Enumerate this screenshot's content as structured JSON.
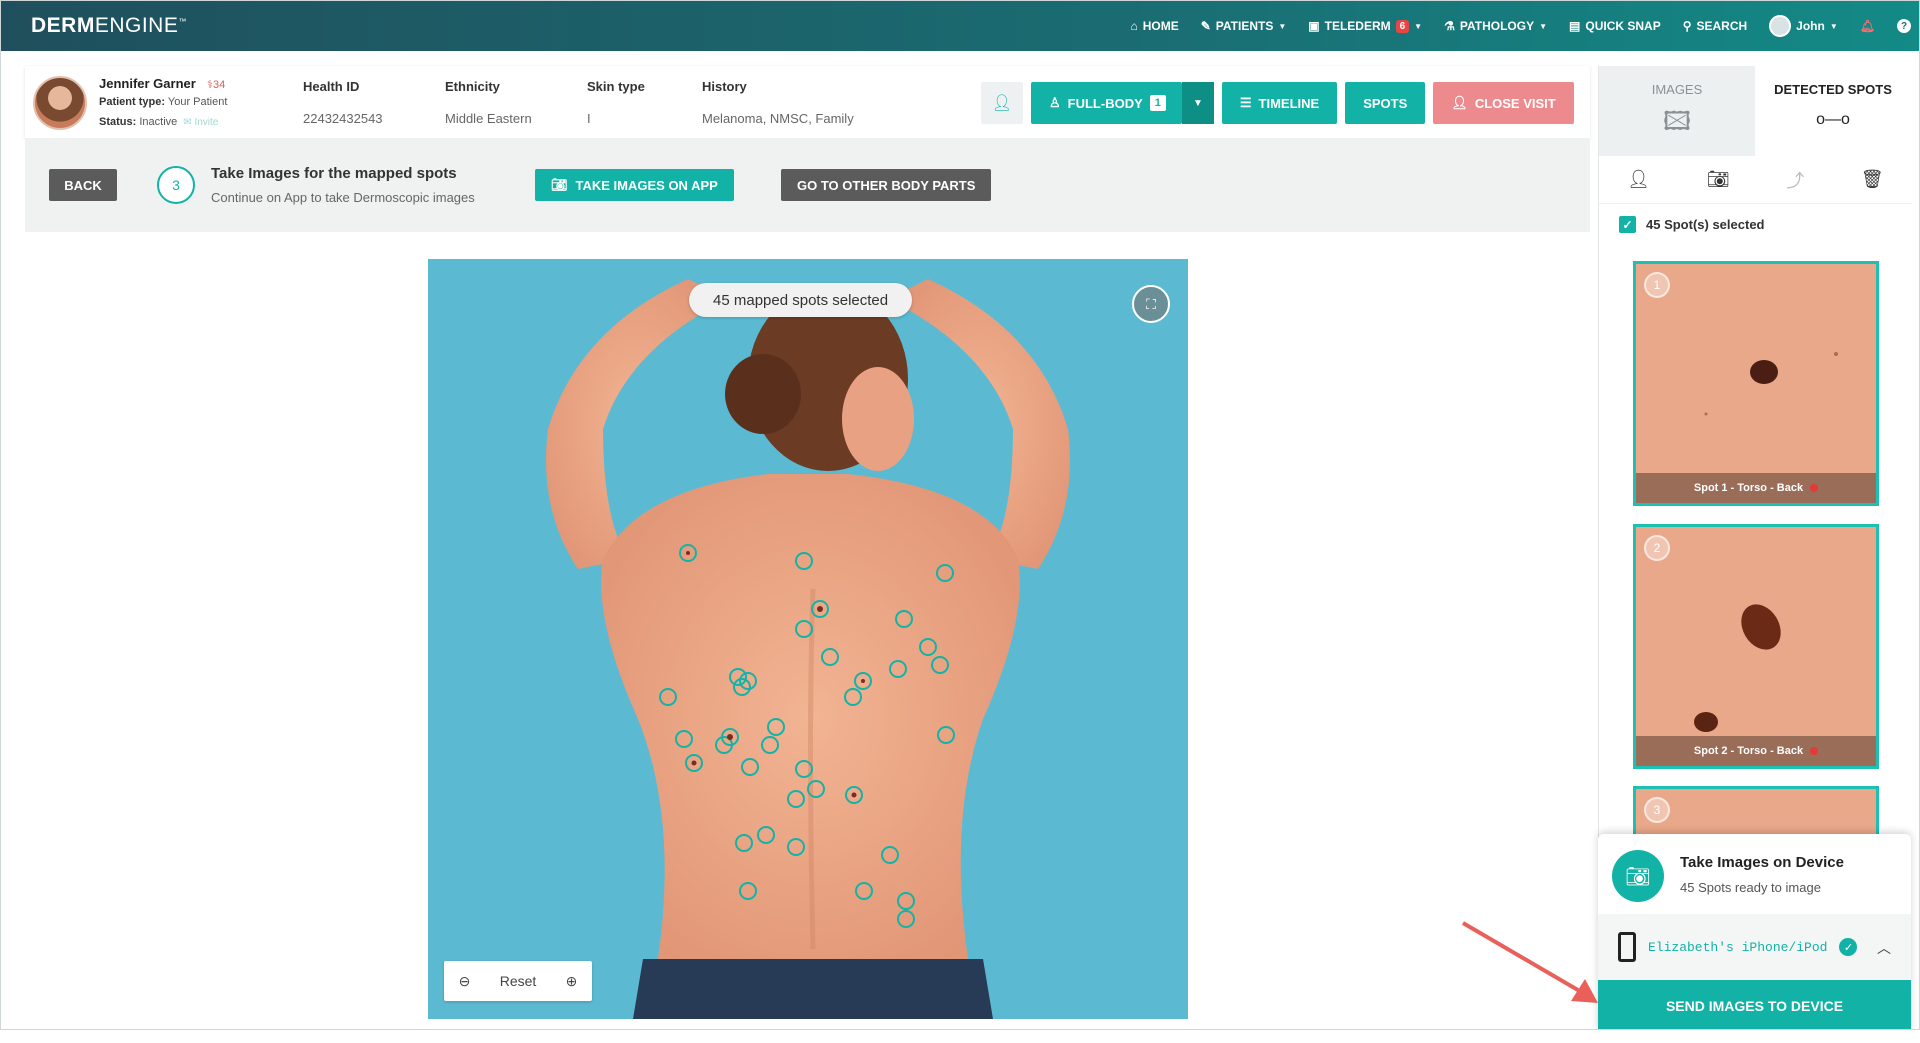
{
  "app": {
    "logo_bold": "DERM",
    "logo_light": "ENGINE",
    "logo_tm": "™"
  },
  "nav": {
    "items": [
      {
        "label": "HOME",
        "icon": "home-icon"
      },
      {
        "label": "PATIENTS",
        "icon": "patients-icon"
      },
      {
        "label": "TELEDERM",
        "icon": "telederm-icon",
        "badge": "6"
      },
      {
        "label": "PATHOLOGY",
        "icon": "pathology-icon"
      },
      {
        "label": "QUICK SNAP",
        "icon": "quick-snap-icon"
      },
      {
        "label": "SEARCH",
        "icon": "search-icon"
      }
    ],
    "user": "John"
  },
  "patient": {
    "name": "Jennifer Garner",
    "age": "34",
    "type_label": "Patient type:",
    "type_value": "Your Patient",
    "status_label": "Status:",
    "status_value": "Inactive",
    "invite": "Invite",
    "health_id_label": "Health ID",
    "health_id": "22432432543",
    "ethnicity_label": "Ethnicity",
    "ethnicity": "Middle Eastern",
    "skin_type_label": "Skin type",
    "skin_type": "I",
    "history_label": "History",
    "history": "Melanoma, NMSC, Family"
  },
  "header_buttons": {
    "full_body": "FULL-BODY",
    "full_body_count": "1",
    "timeline": "TIMELINE",
    "spots": "SPOTS",
    "close_visit": "CLOSE VISIT"
  },
  "step": {
    "back": "BACK",
    "number": "3",
    "title": "Take Images for the mapped spots",
    "subtitle": "Continue on App to take Dermoscopic images",
    "take_images_btn": "TAKE IMAGES ON APP",
    "other_parts_btn": "GO TO OTHER BODY PARTS"
  },
  "viewer": {
    "pill": "45 mapped spots selected",
    "reset": "Reset"
  },
  "right_panel": {
    "tab_images": "IMAGES",
    "tab_detected": "DETECTED SPOTS",
    "selected": "45 Spot(s) selected",
    "spots": [
      {
        "num": "1",
        "label": "Spot 1 - Torso - Back"
      },
      {
        "num": "2",
        "label": "Spot 2 - Torso - Back"
      },
      {
        "num": "3",
        "label": ""
      }
    ]
  },
  "device_panel": {
    "title": "Take Images on Device",
    "subtitle": "45 Spots ready to image",
    "device": "Elizabeth's iPhone/iPod",
    "send": "SEND IMAGES TO DEVICE"
  },
  "colors": {
    "accent": "#12b3a6",
    "nav_dark": "#1f4f5c",
    "close_visit": "#ec8a8e",
    "alert": "#e94545"
  }
}
